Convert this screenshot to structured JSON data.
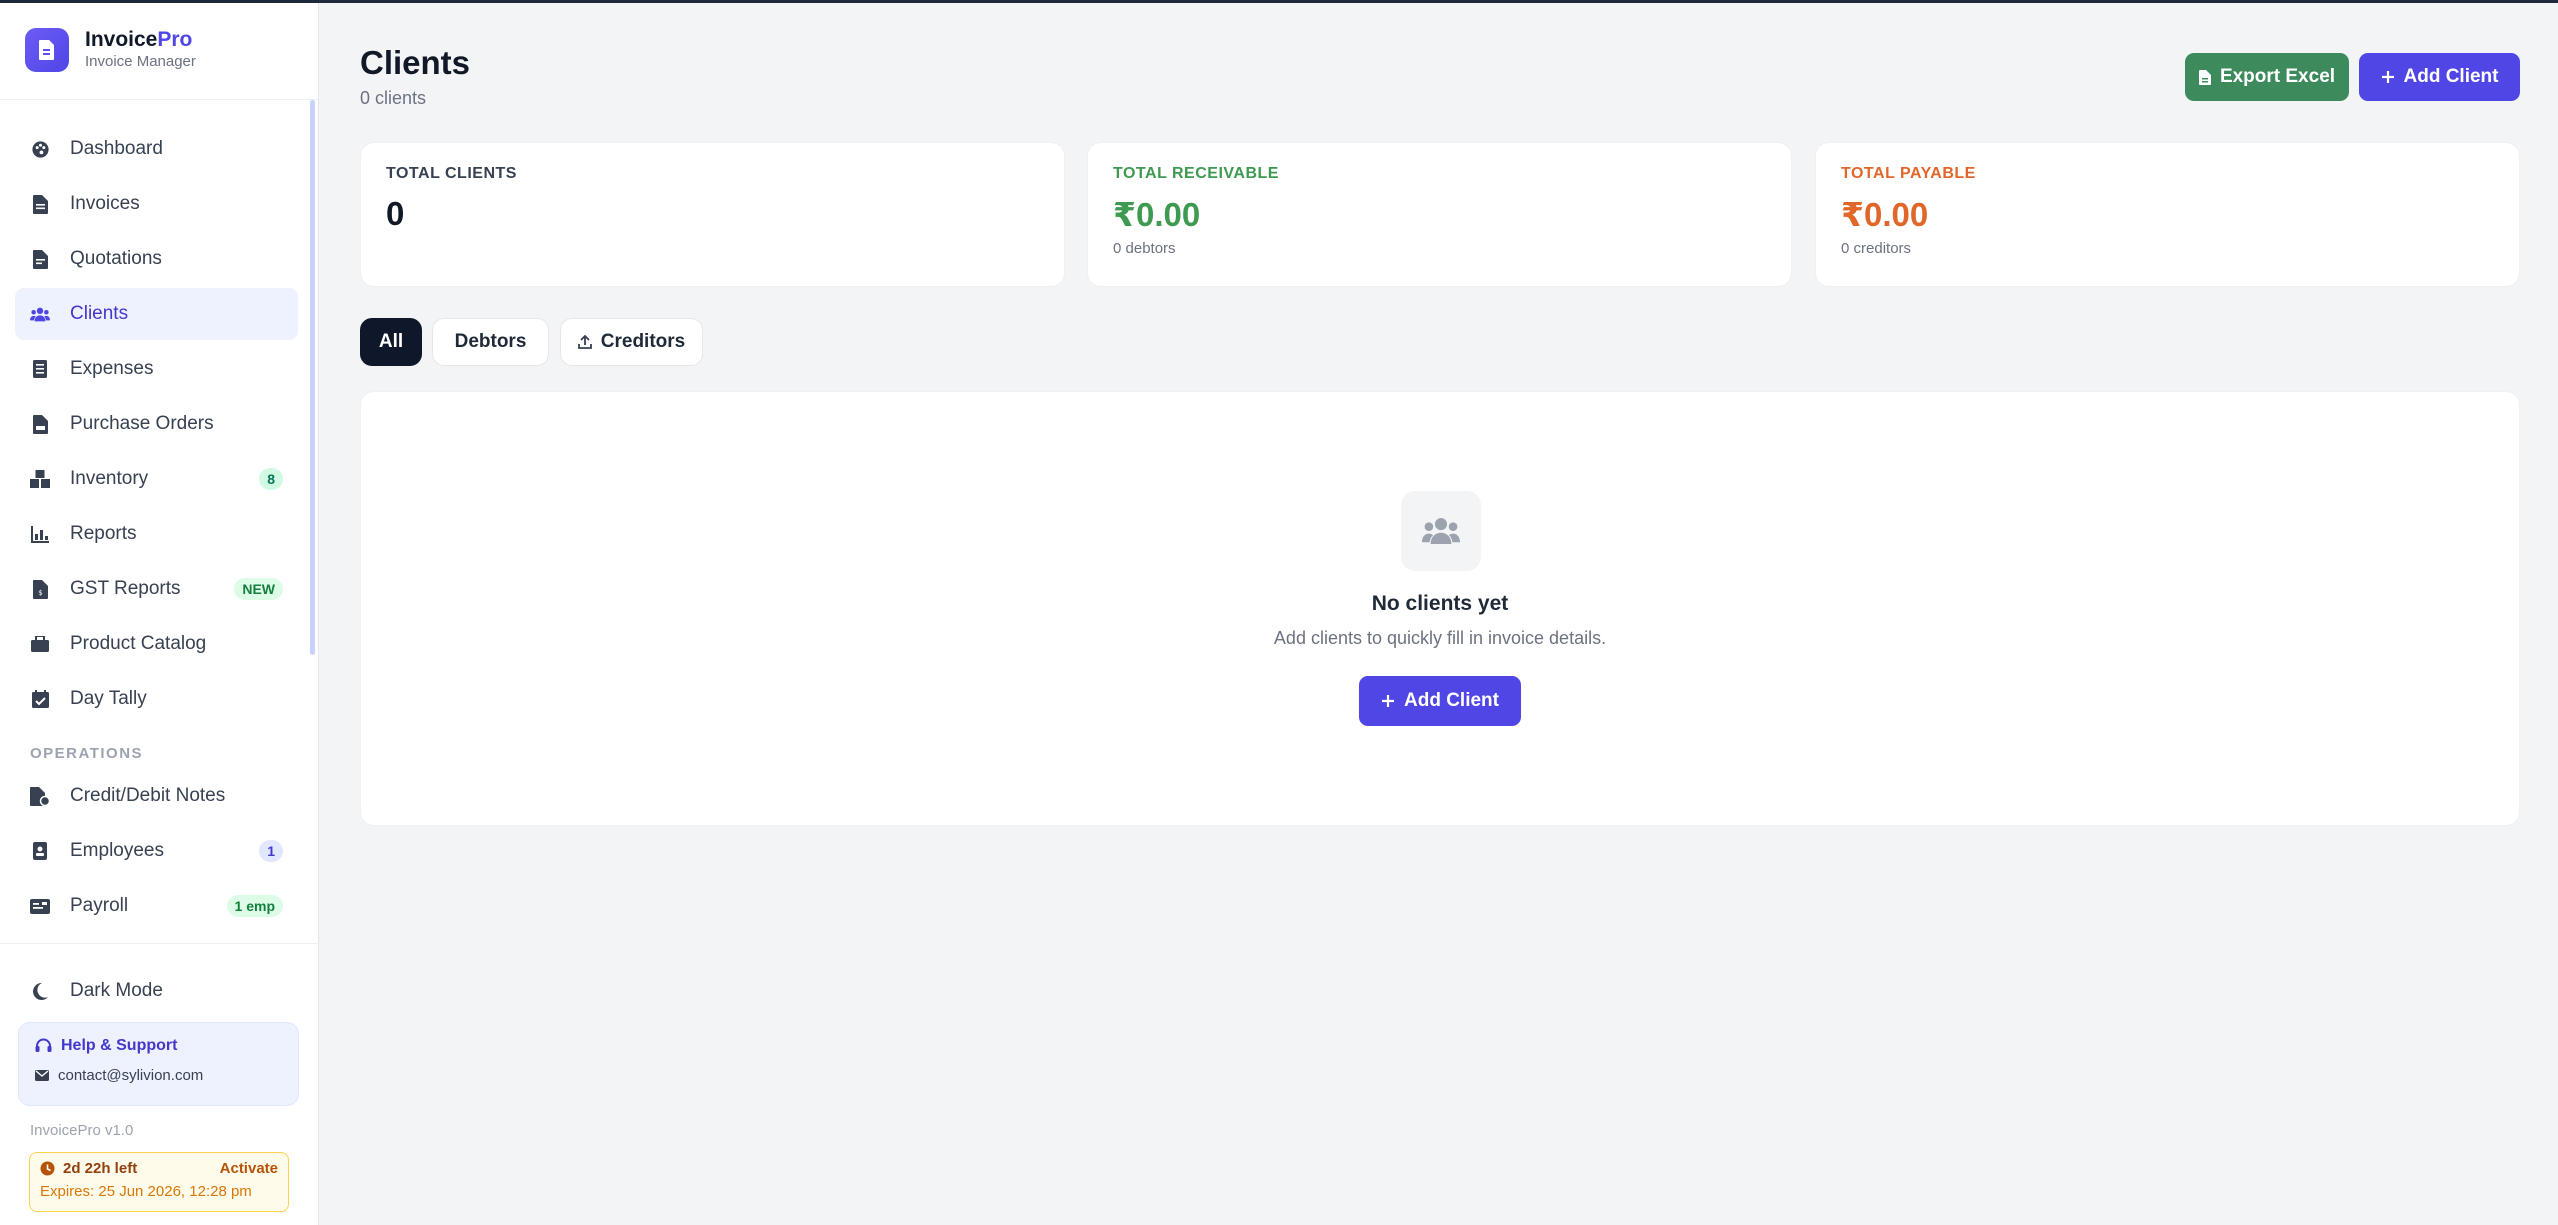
{
  "brand": {
    "name_main": "Invoice",
    "name_accent": "Pro",
    "subtitle": "Invoice Manager"
  },
  "sidebar": {
    "items": [
      {
        "label": "Dashboard",
        "icon": "palette-icon"
      },
      {
        "label": "Invoices",
        "icon": "file-invoice-icon"
      },
      {
        "label": "Quotations",
        "icon": "file-lines-icon"
      },
      {
        "label": "Clients",
        "icon": "users-icon",
        "active": true
      },
      {
        "label": "Expenses",
        "icon": "receipt-icon"
      },
      {
        "label": "Purchase Orders",
        "icon": "file-po-icon"
      },
      {
        "label": "Inventory",
        "icon": "boxes-icon",
        "badge": "8"
      },
      {
        "label": "Reports",
        "icon": "chart-bar-icon"
      },
      {
        "label": "GST Reports",
        "icon": "file-gst-icon",
        "badge": "NEW"
      },
      {
        "label": "Product Catalog",
        "icon": "store-icon"
      },
      {
        "label": "Day Tally",
        "icon": "calendar-check-icon"
      }
    ],
    "section_operations": "OPERATIONS",
    "ops_items": [
      {
        "label": "Credit/Debit Notes",
        "icon": "file-note-icon"
      },
      {
        "label": "Employees",
        "icon": "id-badge-icon",
        "badge": "1"
      },
      {
        "label": "Payroll",
        "icon": "money-check-icon",
        "badge": "1 emp"
      }
    ],
    "dark_mode": "Dark Mode",
    "help": {
      "title": "Help & Support",
      "email": "contact@sylivion.com"
    },
    "version": "InvoicePro v1.0",
    "trial": {
      "left": "2d 22h left",
      "activate": "Activate",
      "expires": "Expires: 25 Jun 2026, 12:28 pm"
    }
  },
  "header": {
    "title": "Clients",
    "subtitle": "0 clients",
    "export_label": "Export Excel",
    "add_label": "Add Client"
  },
  "stats": [
    {
      "label": "TOTAL CLIENTS",
      "value": "0",
      "sub": "",
      "color": "#374151"
    },
    {
      "label": "TOTAL RECEIVABLE",
      "value": "₹0.00",
      "sub": "0 debtors",
      "color": "#3d9a50"
    },
    {
      "label": "TOTAL PAYABLE",
      "value": "₹0.00",
      "sub": "0 creditors",
      "color": "#e0662a"
    }
  ],
  "tabs": [
    "All",
    "Debtors",
    "Creditors"
  ],
  "empty": {
    "title": "No clients yet",
    "description": "Add clients to quickly fill in invoice details.",
    "button": "Add Client"
  },
  "colors": {
    "accent": "#4f46e5",
    "export_green": "#3d8b5c",
    "active_tab": "#0f172a"
  }
}
